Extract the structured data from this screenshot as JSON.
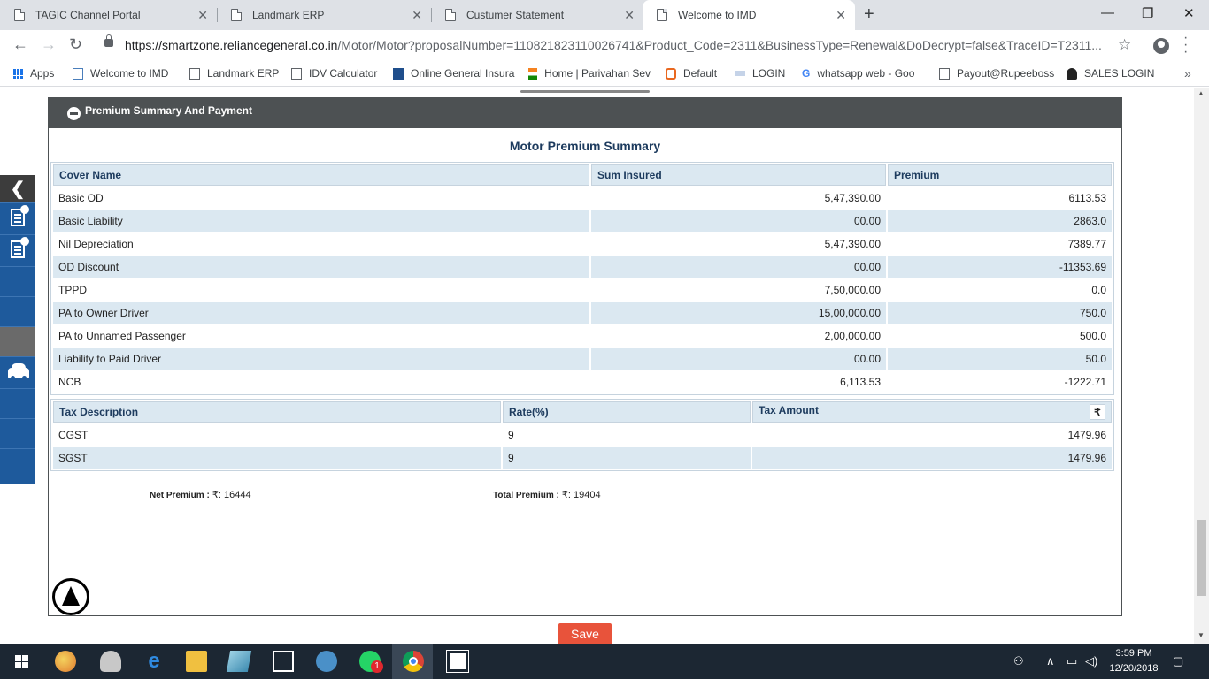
{
  "browser": {
    "tabs": [
      {
        "title": "TAGIC Channel Portal",
        "close": "✕"
      },
      {
        "title": "Landmark ERP",
        "close": "✕"
      },
      {
        "title": "Custumer Statement",
        "close": "✕"
      },
      {
        "title": "Welcome to IMD",
        "close": "✕"
      }
    ],
    "new_tab": "+",
    "window_controls": {
      "minimize": "—",
      "maximize": "❐",
      "close": "✕"
    },
    "url_host": "https://smartzone.reliancegeneral.co.in",
    "url_path": "/Motor/Motor?proposalNumber=110821823110026741&Product_Code=2311&BusinessType=Renewal&DoDecrypt=false&TraceID=T2311...",
    "bookmarks": [
      "Apps",
      "Welcome to IMD",
      "Landmark ERP",
      "IDV Calculator",
      "Online General Insura",
      "Home | Parivahan Sev",
      "Default",
      "LOGIN",
      "whatsapp web - Goo",
      "Payout@Rupeeboss",
      "SALES LOGIN"
    ],
    "bookmarks_more": "»"
  },
  "panel": {
    "header": "Premium Summary And Payment",
    "summary_title": "Motor Premium Summary"
  },
  "cover_table": {
    "headers": [
      "Cover Name",
      "Sum Insured",
      "Premium"
    ],
    "rows": [
      [
        "Basic OD",
        "5,47,390.00",
        "6113.53"
      ],
      [
        "Basic Liability",
        "00.00",
        "2863.0"
      ],
      [
        "Nil Depreciation",
        "5,47,390.00",
        "7389.77"
      ],
      [
        "OD Discount",
        "00.00",
        "-11353.69"
      ],
      [
        "TPPD",
        "7,50,000.00",
        "0.0"
      ],
      [
        "PA to Owner Driver",
        "15,00,000.00",
        "750.0"
      ],
      [
        "PA to Unnamed Passenger",
        "2,00,000.00",
        "500.0"
      ],
      [
        "Liability to Paid Driver",
        "00.00",
        "50.0"
      ],
      [
        "NCB",
        "6,113.53",
        "-1222.71"
      ]
    ]
  },
  "tax_table": {
    "headers": [
      "Tax Description",
      "Rate(%)",
      "Tax Amount"
    ],
    "currency_symbol": "₹",
    "rows": [
      [
        "CGST",
        "9",
        "1479.96"
      ],
      [
        "SGST",
        "9",
        "1479.96"
      ]
    ]
  },
  "totals": {
    "net_label": "Net Premium :",
    "net_value": "₹: 16444",
    "total_label": "Total Premium :",
    "total_value": "₹: 19404"
  },
  "save_label": "Save",
  "sidenav": {
    "collapse": "❮"
  },
  "taskbar": {
    "time": "3:59 PM",
    "date": "12/20/2018",
    "whatsapp_badge": "1"
  },
  "icons": [
    "back-icon",
    "forward-icon",
    "reload-icon",
    "lock-icon",
    "star-icon",
    "profile-icon",
    "menu-icon",
    "minus-circle-icon",
    "scroll-top-icon",
    "car-icon",
    "document-icon"
  ]
}
